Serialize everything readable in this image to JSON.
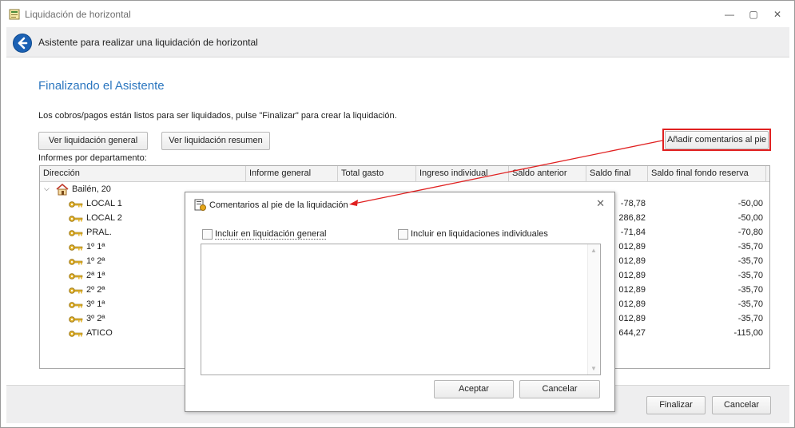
{
  "window": {
    "title": "Liquidación de horizontal",
    "minimize": "—",
    "maximize": "▢",
    "close": "✕"
  },
  "header": {
    "title": "Asistente para realizar una liquidación de horizontal"
  },
  "main": {
    "page_title": "Finalizando el Asistente",
    "intro": "Los cobros/pagos están listos para ser liquidados, pulse \"Finalizar\" para crear la liquidación.",
    "btn_general": "Ver liquidación general",
    "btn_resumen": "Ver liquidación resumen",
    "btn_comentarios": "Añadir comentarios al pie",
    "section_label": "Informes por departamento:"
  },
  "grid": {
    "columns": [
      "Dirección",
      "Informe general",
      "Total gasto",
      "Ingreso individual",
      "Saldo anterior",
      "Saldo final",
      "Saldo final fondo reserva"
    ],
    "group": "Bailén, 20",
    "rows": [
      {
        "name": "LOCAL 1",
        "saldo_final": "-78,78",
        "fondo": "-50,00"
      },
      {
        "name": "LOCAL 2",
        "saldo_final": "286,82",
        "fondo": "-50,00"
      },
      {
        "name": "PRAL.",
        "saldo_final": "-71,84",
        "fondo": "-70,80"
      },
      {
        "name": "1º 1ª",
        "saldo_final": "012,89",
        "fondo": "-35,70"
      },
      {
        "name": "1º 2ª",
        "saldo_final": "012,89",
        "fondo": "-35,70"
      },
      {
        "name": "2ª 1ª",
        "saldo_final": "012,89",
        "fondo": "-35,70"
      },
      {
        "name": "2º 2ª",
        "saldo_final": "012,89",
        "fondo": "-35,70"
      },
      {
        "name": "3º 1ª",
        "saldo_final": "012,89",
        "fondo": "-35,70"
      },
      {
        "name": "3º 2ª",
        "saldo_final": "012,89",
        "fondo": "-35,70"
      },
      {
        "name": "ATICO",
        "saldo_final": "644,27",
        "fondo": "-115,00"
      }
    ]
  },
  "dialog": {
    "title": "Comentarios al pie de la liquidación",
    "close": "✕",
    "chk_general": "Incluir en liquidación general",
    "chk_individual": "Incluir en liquidaciones individuales",
    "memo_value": "",
    "accept": "Aceptar",
    "cancel": "Cancelar",
    "scroll_up": "▲",
    "scroll_down": "▼"
  },
  "footer": {
    "finish": "Finalizar",
    "cancel": "Cancelar"
  },
  "colors": {
    "accent": "#2b76bf",
    "highlight": "#e02020",
    "back_button": "#1b61b4"
  }
}
